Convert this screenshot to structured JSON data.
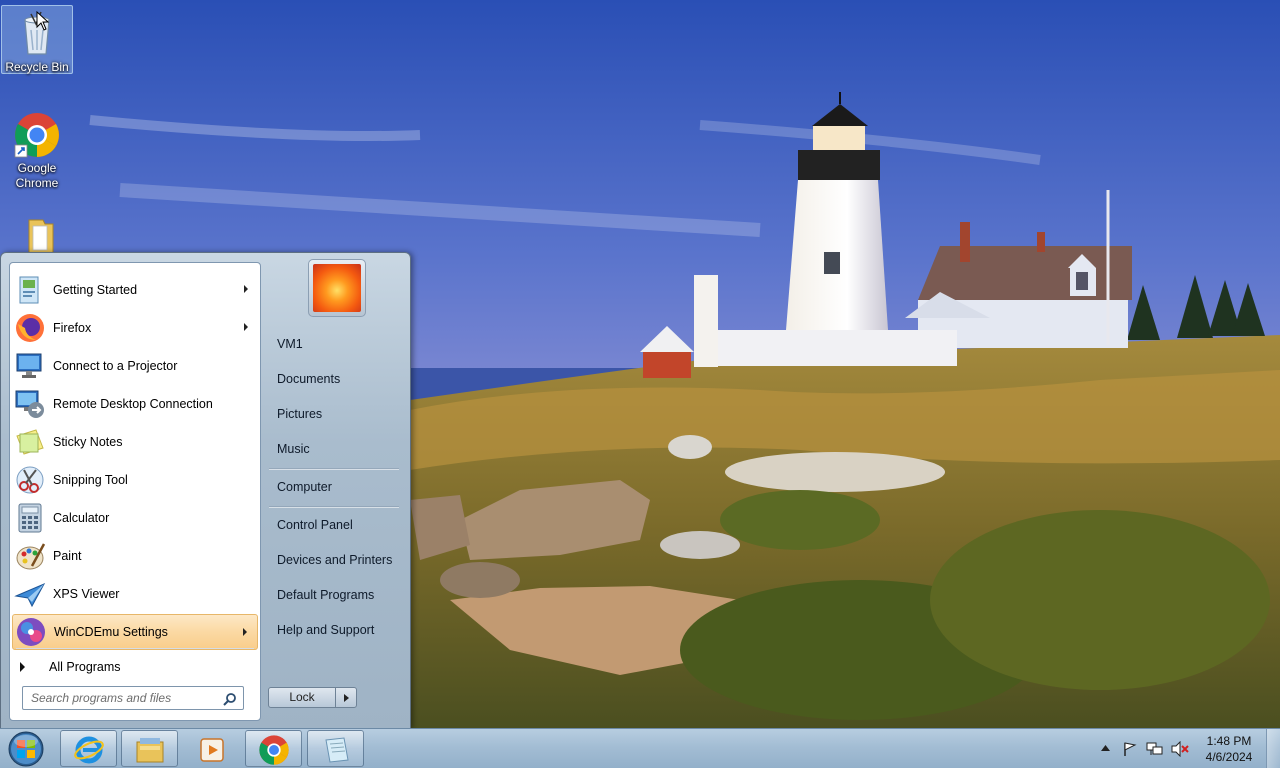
{
  "desktop": {
    "icons": [
      {
        "label": "Recycle Bin",
        "icon": "recycle-bin-icon"
      },
      {
        "label": "Google Chrome",
        "icon": "chrome-icon"
      },
      {
        "label": "",
        "icon": "folder-icon"
      }
    ]
  },
  "start_menu": {
    "programs": [
      {
        "label": "Getting Started",
        "icon": "getting-started-icon",
        "has_submenu": true
      },
      {
        "label": "Firefox",
        "icon": "firefox-icon",
        "has_submenu": true
      },
      {
        "label": "Connect to a Projector",
        "icon": "projector-icon",
        "has_submenu": false
      },
      {
        "label": "Remote Desktop Connection",
        "icon": "remote-desktop-icon",
        "has_submenu": false
      },
      {
        "label": "Sticky Notes",
        "icon": "sticky-notes-icon",
        "has_submenu": false
      },
      {
        "label": "Snipping Tool",
        "icon": "snipping-tool-icon",
        "has_submenu": false
      },
      {
        "label": "Calculator",
        "icon": "calculator-icon",
        "has_submenu": false
      },
      {
        "label": "Paint",
        "icon": "paint-icon",
        "has_submenu": false
      },
      {
        "label": "XPS Viewer",
        "icon": "xps-viewer-icon",
        "has_submenu": false
      },
      {
        "label": "WinCDEmu Settings",
        "icon": "wincdemu-icon",
        "has_submenu": true,
        "selected": true
      }
    ],
    "all_programs_label": "All Programs",
    "search_placeholder": "Search programs and files",
    "right_links": [
      {
        "label": "VM1"
      },
      {
        "label": "Documents"
      },
      {
        "label": "Pictures"
      },
      {
        "label": "Music"
      },
      {
        "label": "Computer"
      },
      {
        "label": "Control Panel"
      },
      {
        "label": "Devices and Printers"
      },
      {
        "label": "Default Programs"
      },
      {
        "label": "Help and Support"
      }
    ],
    "lock_label": "Lock"
  },
  "taskbar": {
    "pinned": [
      {
        "name": "internet-explorer-icon"
      },
      {
        "name": "file-explorer-icon"
      },
      {
        "name": "media-player-icon"
      },
      {
        "name": "chrome-icon"
      },
      {
        "name": "notepad-icon"
      }
    ],
    "clock_time": "1:48 PM",
    "clock_date": "4/6/2024"
  },
  "colors": {
    "accent": "#a3bdd4",
    "selection": "#fbd9a3",
    "start_menu_bg": "#a9bccd"
  }
}
